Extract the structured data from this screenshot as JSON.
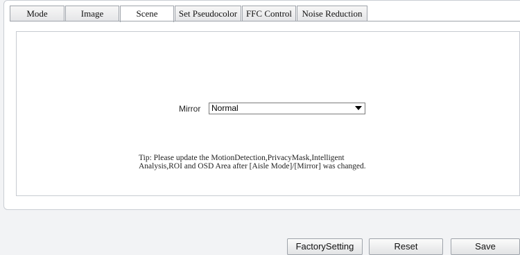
{
  "tabs": [
    {
      "label": "Mode"
    },
    {
      "label": "Image"
    },
    {
      "label": "Scene"
    },
    {
      "label": "Set Pseudocolor"
    },
    {
      "label": "FFC Control"
    },
    {
      "label": "Noise Reduction"
    }
  ],
  "active_tab": "Scene",
  "mirror": {
    "label": "Mirror",
    "selected": "Normal"
  },
  "tip": "Tip: Please update the MotionDetection,PrivacyMask,Intelligent Analysis,ROI and OSD Area after [Aisle Mode]/[Mirror] was changed.",
  "buttons": {
    "factory_setting": "FactorySetting",
    "reset": "Reset",
    "save": "Save"
  }
}
